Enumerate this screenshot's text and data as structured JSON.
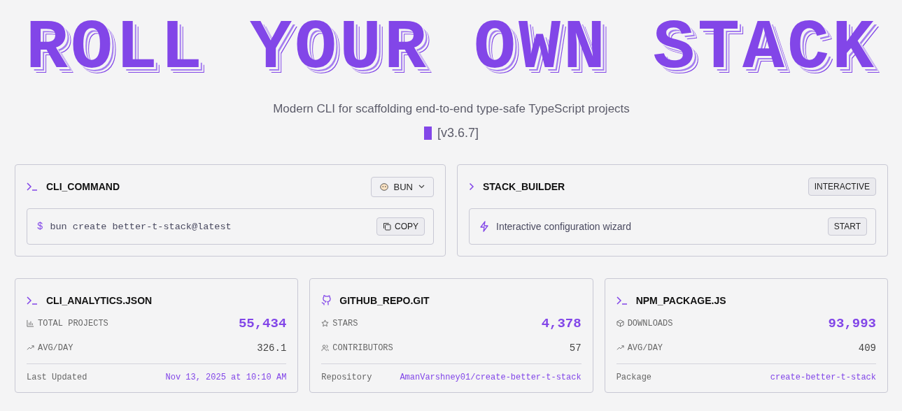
{
  "title": "ROLL YOUR OWN STACK",
  "subtitle": "Modern CLI for scaffolding end-to-end type-safe TypeScript projects",
  "version": "[v3.6.7]",
  "cli_command": {
    "title": "CLI_COMMAND",
    "package_manager": "BUN",
    "prompt": "$",
    "command": "bun create better-t-stack@latest",
    "copy_button": "COPY"
  },
  "stack_builder": {
    "title": "STACK_BUILDER",
    "badge": "INTERACTIVE",
    "description": "Interactive configuration wizard",
    "start_button": "START"
  },
  "stat_cards": [
    {
      "title": "CLI_ANALYTICS.JSON",
      "rows": [
        {
          "label": "TOTAL PROJECTS",
          "value": "55,434",
          "highlight": true
        },
        {
          "label": "AVG/DAY",
          "value": "326.1",
          "highlight": false
        }
      ],
      "footer_label": "Last Updated",
      "footer_value": "Nov 13, 2025 at 10:10 AM"
    },
    {
      "title": "GITHUB_REPO.GIT",
      "rows": [
        {
          "label": "STARS",
          "value": "4,378",
          "highlight": true
        },
        {
          "label": "CONTRIBUTORS",
          "value": "57",
          "highlight": false
        }
      ],
      "footer_label": "Repository",
      "footer_value": "AmanVarshney01/create-better-t-stack"
    },
    {
      "title": "NPM_PACKAGE.JS",
      "rows": [
        {
          "label": "DOWNLOADS",
          "value": "93,993",
          "highlight": true
        },
        {
          "label": "AVG/DAY",
          "value": "409",
          "highlight": false
        }
      ],
      "footer_label": "Package",
      "footer_value": "create-better-t-stack"
    }
  ]
}
